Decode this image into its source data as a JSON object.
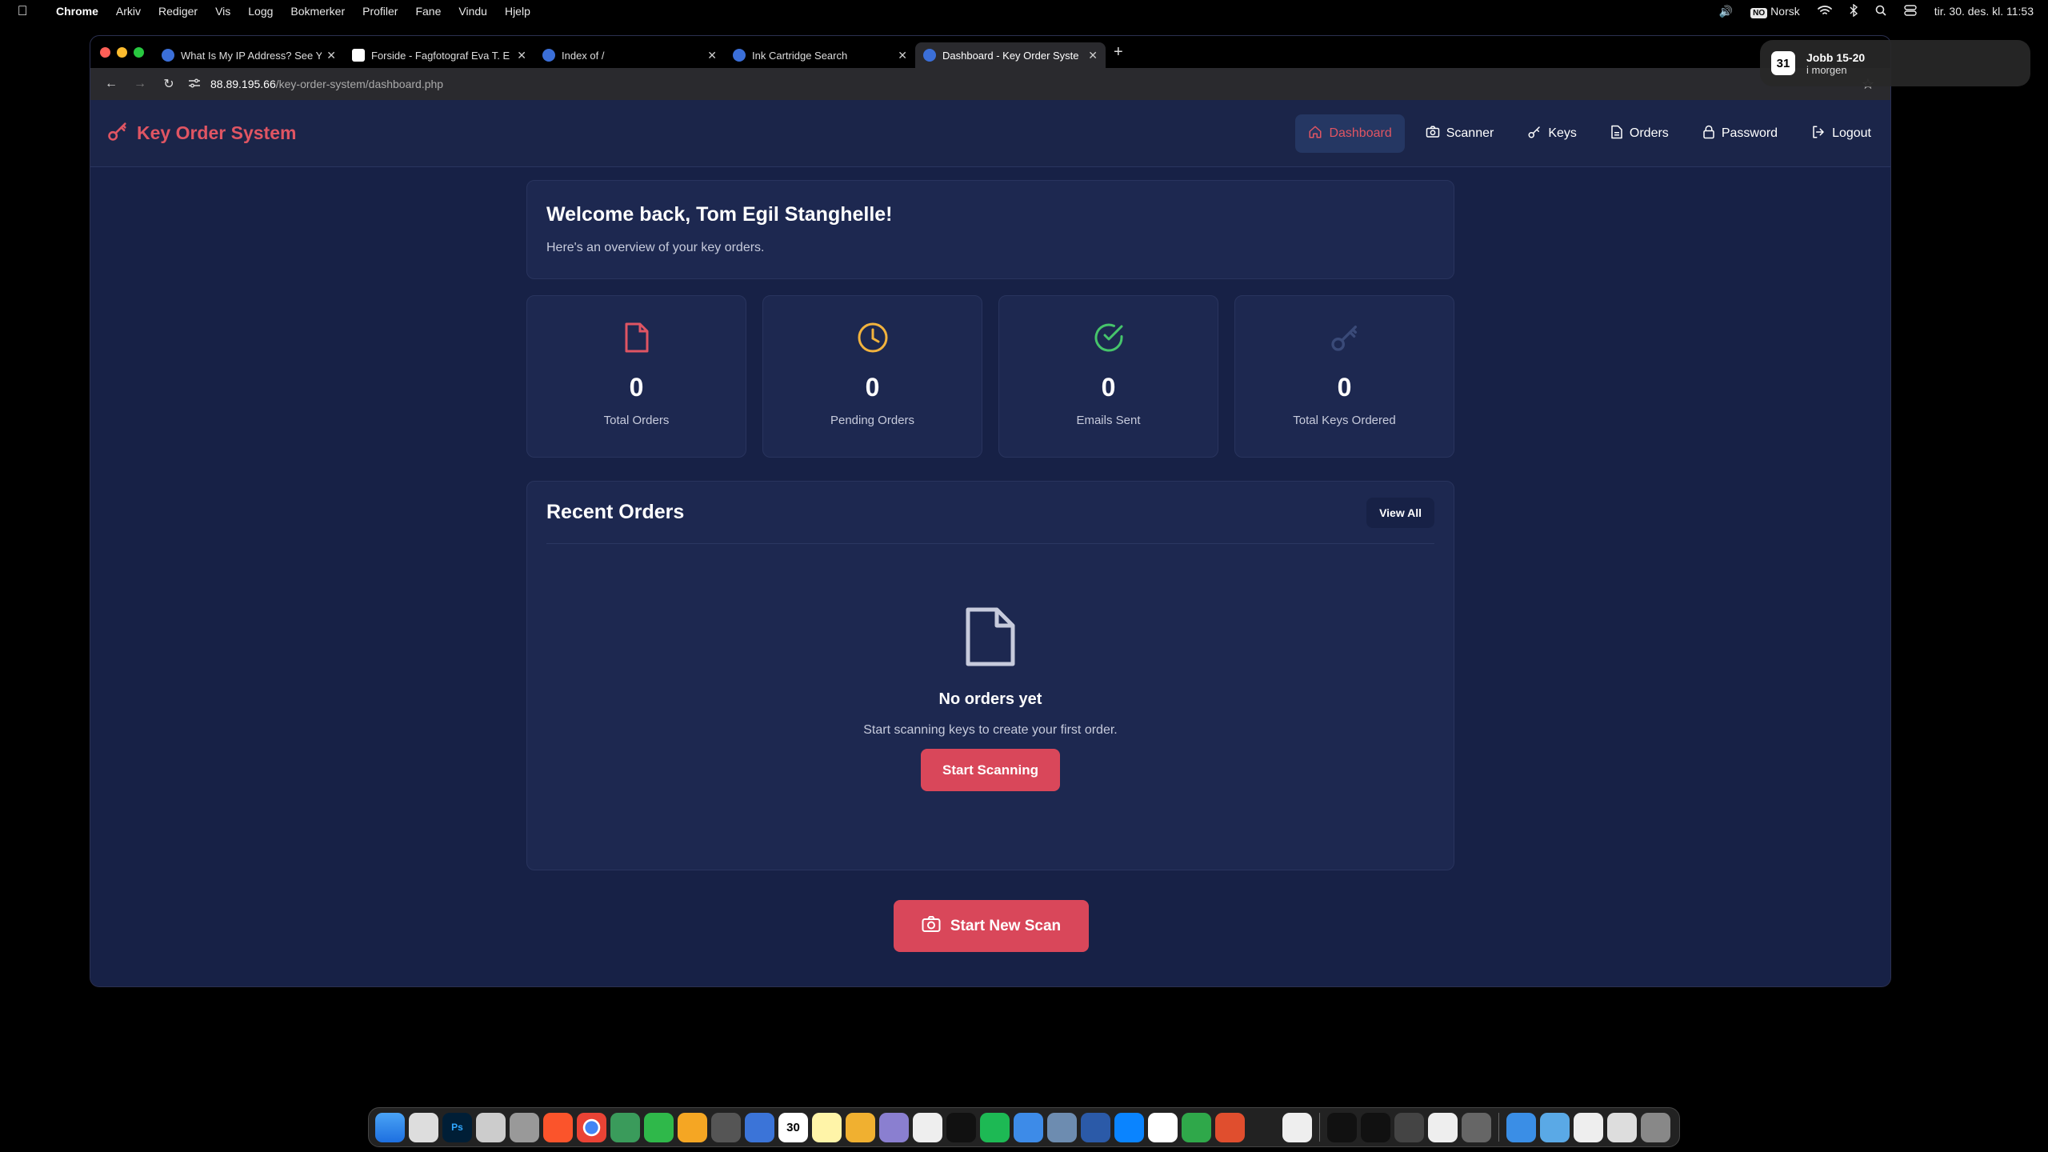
{
  "menubar": {
    "app_name": "Chrome",
    "items": [
      "Arkiv",
      "Rediger",
      "Vis",
      "Logg",
      "Bokmerker",
      "Profiler",
      "Fane",
      "Vindu",
      "Hjelp"
    ],
    "keyboard_badge": "NO",
    "keyboard_label": "Norsk",
    "datetime": "tir. 30. des. kl. 11:53"
  },
  "notification": {
    "icon_text": "31",
    "title": "Jobb 15-20",
    "subtitle": "i morgen"
  },
  "browser": {
    "tabs": [
      {
        "label": "What Is My IP Address? See Y",
        "favicon_color": "#3b6fd8"
      },
      {
        "label": "Forside - Fagfotograf Eva T. E",
        "favicon_color": "#ffffff"
      },
      {
        "label": "Index of /",
        "favicon_color": "#3b6fd8"
      },
      {
        "label": "Ink Cartridge Search",
        "favicon_color": "#3b6fd8"
      },
      {
        "label": "Dashboard - Key Order Syste",
        "favicon_color": "#3b6fd8"
      }
    ],
    "url_host": "88.89.195.66",
    "url_path": "/key-order-system/dashboard.php"
  },
  "app": {
    "brand": "Key Order System",
    "nav": [
      {
        "label": "Dashboard",
        "icon": "home-icon",
        "active": true
      },
      {
        "label": "Scanner",
        "icon": "camera-icon",
        "active": false
      },
      {
        "label": "Keys",
        "icon": "key-icon",
        "active": false
      },
      {
        "label": "Orders",
        "icon": "document-icon",
        "active": false
      },
      {
        "label": "Password",
        "icon": "lock-icon",
        "active": false
      },
      {
        "label": "Logout",
        "icon": "logout-icon",
        "active": false
      }
    ],
    "welcome_title": "Welcome back, Tom Egil Stanghelle!",
    "welcome_subtitle": "Here's an overview of your key orders.",
    "stats": [
      {
        "value": "0",
        "label": "Total Orders",
        "icon": "document-icon",
        "color": "#e05563"
      },
      {
        "value": "0",
        "label": "Pending Orders",
        "icon": "clock-icon",
        "color": "#f2b33d"
      },
      {
        "value": "0",
        "label": "Emails Sent",
        "icon": "check-circle-icon",
        "color": "#46c46b"
      },
      {
        "value": "0",
        "label": "Total Keys Ordered",
        "icon": "key-icon",
        "color": "#3a4a78"
      }
    ],
    "recent_title": "Recent Orders",
    "view_all": "View All",
    "empty_title": "No orders yet",
    "empty_text": "Start scanning keys to create your first order.",
    "start_scanning": "Start Scanning",
    "start_new_scan": "Start New Scan"
  },
  "dock": {
    "calendar_day": "30"
  },
  "colors": {
    "accent": "#e05563",
    "page_bg": "#172146",
    "card_bg": "#1d2850",
    "button_red": "#d9475a"
  }
}
